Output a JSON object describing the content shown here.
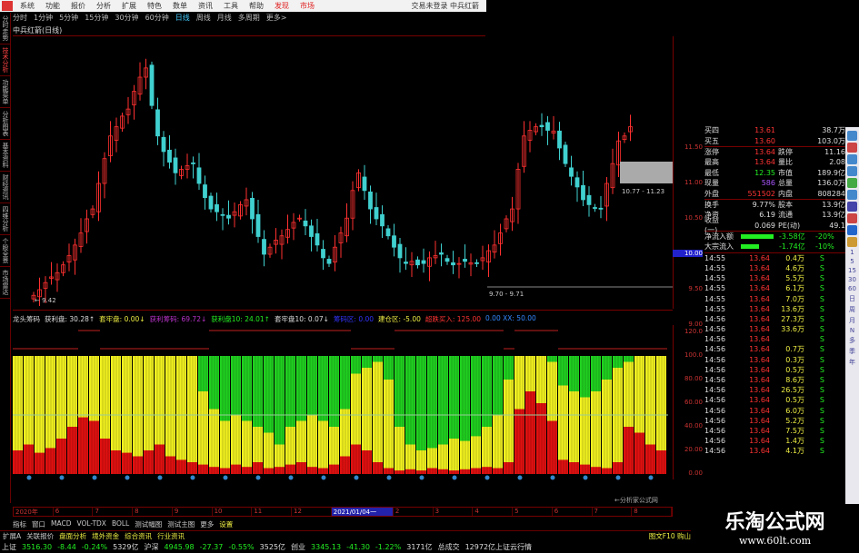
{
  "menubar": {
    "items": [
      "系统",
      "功能",
      "报价",
      "分析",
      "扩展",
      "特色",
      "数单",
      "资讯",
      "工具",
      "帮助"
    ],
    "red_items": [
      "发现",
      "市场"
    ],
    "account": "交易未登录 中兵红箭"
  },
  "left_tabs": [
    "分时走势",
    "技术分析",
    "功能菜单",
    "分析图表",
    "基本资料",
    "财经资讯",
    "四维分析",
    "个股全景",
    "市场雷达"
  ],
  "periods": {
    "items": [
      "分时",
      "1分钟",
      "5分钟",
      "15分钟",
      "30分钟",
      "60分钟",
      "日线",
      "周线",
      "月线",
      "多周期",
      "更多>"
    ],
    "active": "日线"
  },
  "chart_title": "中兵红箭(日线)",
  "price_chart": {
    "type": "candlestick",
    "y_ticks": [
      "11.50",
      "11.00",
      "10.50",
      "10.00",
      "9.50",
      "9.00"
    ],
    "y_tick_values": [
      11.5,
      11.0,
      10.5,
      10.0,
      9.5,
      9.0
    ],
    "highlight_tick": "10.00",
    "low_label": "9.42",
    "range_label_1": "10.77 - 11.23",
    "range_label_2": "9.70 - 9.71",
    "closes": [
      9.42,
      9.5,
      9.6,
      9.68,
      9.74,
      9.85,
      9.98,
      10.13,
      10.3,
      10.5,
      10.64,
      11.0,
      11.35,
      11.67,
      11.8,
      11.95,
      12.05,
      12.3,
      12.5,
      12.63,
      12.1,
      11.67,
      11.45,
      11.3,
      11.15,
      11.2,
      11.25,
      11.28,
      11.0,
      10.8,
      10.64,
      10.6,
      10.55,
      10.51,
      10.6,
      10.7,
      10.77,
      10.5,
      10.25,
      10.0,
      10.1,
      10.2,
      10.26,
      10.35,
      10.45,
      10.51,
      10.4,
      10.25,
      10.13,
      9.95,
      9.87,
      10.1,
      10.3,
      10.51,
      10.9,
      11.15,
      10.9,
      10.64,
      10.5,
      10.4,
      10.26,
      10.1,
      9.95,
      9.87,
      9.9,
      9.85,
      9.87,
      9.95,
      9.98,
      10.0,
      9.9,
      9.85,
      9.87,
      9.9,
      9.88,
      9.87,
      9.95,
      10.05,
      10.13,
      10.3,
      10.5,
      10.64,
      11.2,
      11.67,
      11.75,
      11.8,
      11.8,
      11.75,
      11.74,
      11.5,
      11.28,
      11.1,
      10.95,
      10.77,
      10.7,
      10.65,
      10.64,
      11.0,
      11.28,
      11.6,
      11.67,
      11.8
    ],
    "up_color": "#ff3030",
    "down_color": "#40d0d0"
  },
  "quote": {
    "top": [
      {
        "l": "买四",
        "v": "13.61",
        "r": "38.7万"
      },
      {
        "l": "买五",
        "v": "13.60",
        "r": "103.0万"
      }
    ],
    "stats": [
      {
        "l": "涨停",
        "v": "13.64",
        "vc": "red",
        "l2": "跌停",
        "v2": "11.16",
        "v2c": "green"
      },
      {
        "l": "最高",
        "v": "13.64",
        "vc": "red",
        "l2": "量比",
        "v2": "2.08",
        "v2c": "red"
      },
      {
        "l": "最低",
        "v": "12.35",
        "vc": "green",
        "l2": "市值",
        "v2": "189.9亿",
        "v2c": "wht"
      },
      {
        "l": "现量",
        "v": "586",
        "vc": "pur",
        "l2": "总量",
        "v2": "136.0万",
        "v2c": "wht"
      },
      {
        "l": "外盘",
        "v": "551502",
        "vc": "red",
        "l2": "内盘",
        "v2": "808284",
        "v2c": "green"
      }
    ],
    "stats2": [
      {
        "l": "换手",
        "v": "9.77%",
        "vc": "wht",
        "l2": "股本",
        "v2": "13.9亿",
        "v2c": "wht"
      },
      {
        "l": "净资",
        "v": "6.19",
        "vc": "wht",
        "l2": "流通",
        "v2": "13.9亿",
        "v2c": "wht"
      },
      {
        "l": "收益(一)",
        "v": "0.069",
        "vc": "wht",
        "l2": "PE(动)",
        "v2": "49.1",
        "v2c": "wht"
      }
    ],
    "flows": [
      {
        "l": "净流入额",
        "v": "-3.58亿",
        "p": "-20%",
        "bar": 0.9
      },
      {
        "l": "大宗流入",
        "v": "-1.74亿",
        "p": "-10%",
        "bar": 0.5
      }
    ]
  },
  "trades": [
    [
      "14:55",
      "13.64",
      "0.4万",
      "S"
    ],
    [
      "14:55",
      "13.64",
      "4.6万",
      "S"
    ],
    [
      "14:55",
      "13.64",
      "5.5万",
      "S"
    ],
    [
      "14:55",
      "13.64",
      "6.1万",
      "S"
    ],
    [
      "14:55",
      "13.64",
      "7.0万",
      "S"
    ],
    [
      "14:55",
      "13.64",
      "13.6万",
      "S"
    ],
    [
      "14:56",
      "13.64",
      "27.3万",
      "S"
    ],
    [
      "14:56",
      "13.64",
      "33.6万",
      "S"
    ],
    [
      "14:56",
      "13.64",
      "",
      "S"
    ],
    [
      "14:56",
      "13.64",
      "0.7万",
      "S"
    ],
    [
      "14:56",
      "13.64",
      "0.3万",
      "S"
    ],
    [
      "14:56",
      "13.64",
      "0.5万",
      "S"
    ],
    [
      "14:56",
      "13.64",
      "8.6万",
      "S"
    ],
    [
      "14:56",
      "13.64",
      "26.5万",
      "S"
    ],
    [
      "14:56",
      "13.64",
      "0.5万",
      "S"
    ],
    [
      "14:56",
      "13.64",
      "6.0万",
      "S"
    ],
    [
      "14:56",
      "13.64",
      "5.2万",
      "S"
    ],
    [
      "14:56",
      "13.64",
      "7.5万",
      "S"
    ],
    [
      "14:56",
      "13.64",
      "1.4万",
      "S"
    ],
    [
      "14:56",
      "13.64",
      "4.1万",
      "S"
    ]
  ],
  "icon_strip": {
    "labels": [
      "1",
      "5",
      "15",
      "30",
      "60",
      "日",
      "周",
      "月",
      "N",
      "多",
      "季",
      "年"
    ]
  },
  "indicator": {
    "header": [
      {
        "t": "龙头筹码",
        "c": "#ddd"
      },
      {
        "t": "获利盘: 30.28↑",
        "c": "#ddd"
      },
      {
        "t": "套牢盘: 0.00↓",
        "c": "#ee4"
      },
      {
        "t": "获利筹码: 69.72↓",
        "c": "#b3c"
      },
      {
        "t": "获利盘10: 24.01↑",
        "c": "#2e2"
      },
      {
        "t": "套牢盘10: 0.07↓",
        "c": "#ddd"
      },
      {
        "t": "筹码区: 0.00",
        "c": "#33f"
      },
      {
        "t": "建仓区: -5.00",
        "c": "#ee4"
      },
      {
        "t": "超跌买入: 125.00",
        "c": "#f33"
      },
      {
        "t": "0.00 XX: 50.00",
        "c": "#38f"
      }
    ],
    "y_ticks": [
      "120.0",
      "100.0",
      "80.00",
      "60.00",
      "40.00",
      "20.00",
      "0.00"
    ],
    "y_tick_values": [
      120,
      100,
      80,
      60,
      40,
      20,
      0
    ],
    "green_pct": [
      0,
      0,
      0,
      0,
      0,
      0,
      0,
      0,
      0,
      0,
      0,
      0,
      0,
      0,
      0,
      0,
      0,
      30,
      45,
      55,
      50,
      55,
      60,
      65,
      75,
      60,
      55,
      50,
      55,
      60,
      45,
      15,
      10,
      5,
      20,
      60,
      75,
      80,
      78,
      75,
      70,
      72,
      68,
      60,
      50,
      20,
      0,
      0,
      0,
      5,
      25,
      30,
      35,
      30,
      20,
      10,
      5,
      0,
      0,
      0
    ],
    "red_pct": [
      20,
      25,
      18,
      22,
      30,
      40,
      48,
      45,
      30,
      20,
      18,
      15,
      20,
      25,
      15,
      12,
      10,
      8,
      6,
      5,
      8,
      6,
      10,
      5,
      6,
      8,
      10,
      6,
      5,
      8,
      15,
      25,
      20,
      10,
      5,
      3,
      4,
      3,
      5,
      4,
      3,
      4,
      5,
      6,
      5,
      10,
      55,
      70,
      60,
      45,
      12,
      10,
      8,
      6,
      5,
      10,
      40,
      35,
      25,
      20
    ],
    "colors": {
      "yellow": "#f0f020",
      "green": "#20d020",
      "red": "#e01010",
      "line": "#c02020"
    },
    "note": "分析家公式网"
  },
  "date_axis": [
    "2020年",
    "6",
    "7",
    "8",
    "9",
    "10",
    "11",
    "12",
    "2021/01/04一",
    "2",
    "3",
    "4",
    "5",
    "6",
    "7",
    "8"
  ],
  "date_highlight": "2021/01/04一",
  "ind_tabs": {
    "items": [
      "指标",
      "窗口",
      "MACD",
      "VOL-TDX",
      "BOLL",
      "测试幅图",
      "测试主图",
      "更多",
      "设置"
    ],
    "active": "设置"
  },
  "ext_row": [
    "扩展A",
    "关联报价",
    "盘面分析",
    "境外资金",
    "综合资讯",
    "行业资讯"
  ],
  "ext_right": "图文F10 购山",
  "status": [
    {
      "t": "上证",
      "c": "#ddd"
    },
    {
      "t": "3516.30",
      "c": "#2e2"
    },
    {
      "t": "-8.44",
      "c": "#2e2"
    },
    {
      "t": "-0.24%",
      "c": "#2e2"
    },
    {
      "t": "5329亿",
      "c": "#ddd"
    },
    {
      "t": "沪深",
      "c": "#ddd"
    },
    {
      "t": "4945.98",
      "c": "#2e2"
    },
    {
      "t": "-27.37",
      "c": "#2e2"
    },
    {
      "t": "-0.55%",
      "c": "#2e2"
    },
    {
      "t": "3525亿",
      "c": "#ddd"
    },
    {
      "t": "创业",
      "c": "#ddd"
    },
    {
      "t": "3345.13",
      "c": "#2e2"
    },
    {
      "t": "-41.30",
      "c": "#2e2"
    },
    {
      "t": "-1.22%",
      "c": "#2e2"
    },
    {
      "t": "3171亿",
      "c": "#ddd"
    },
    {
      "t": "总成交",
      "c": "#ddd"
    },
    {
      "t": "12972亿上证云行情",
      "c": "#ddd"
    }
  ],
  "watermark": {
    "name": "乐淘公式网",
    "url": "www.60lt.com"
  }
}
